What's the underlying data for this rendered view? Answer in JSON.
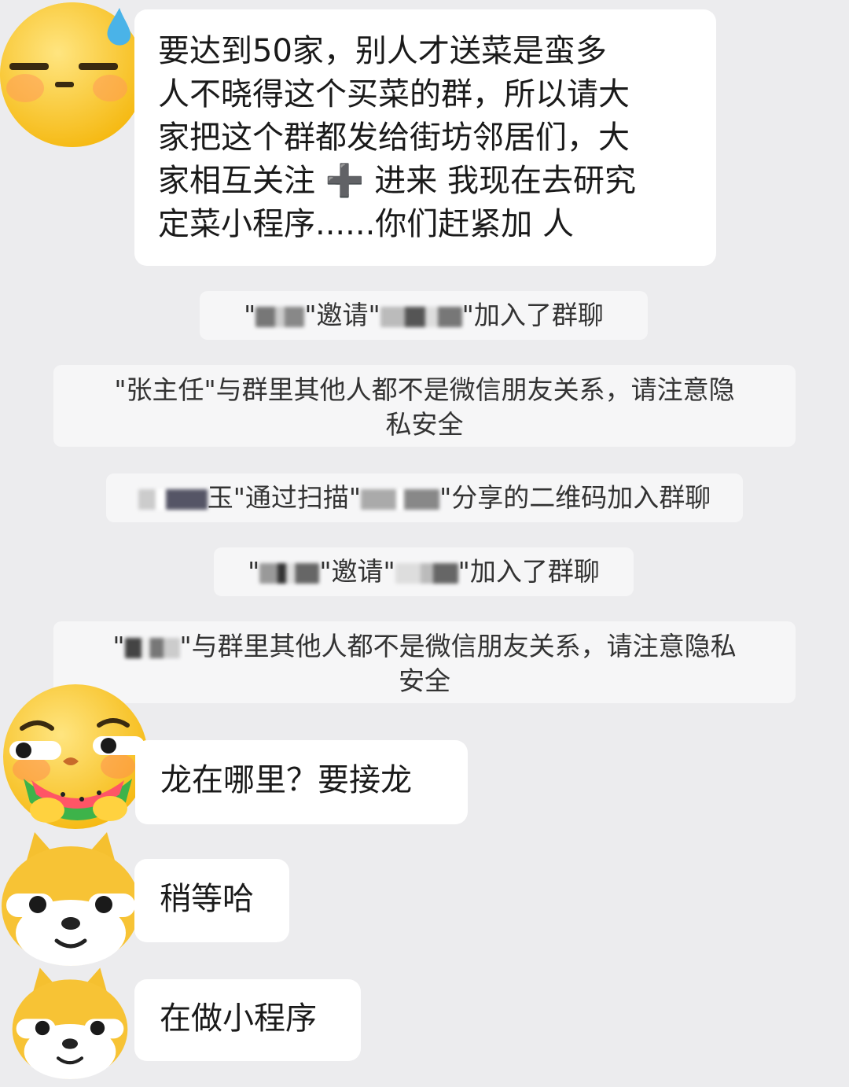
{
  "colors": {
    "background": "#ececee",
    "bubble": "#ffffff",
    "system_bubble": "#f6f6f7",
    "text": "#1a1a1a",
    "system_text": "#333333",
    "emoji_yellow": "#ffd23f"
  },
  "messages": [
    {
      "avatar_icon": "sweat-face-emoji-icon",
      "text": "要达到50家，别人才送菜是蛮多\n人不晓得这个买菜的群，所以请大\n家把这个群都发给街坊邻居们，大\n家相互关注 ➕ 进来 我现在去研究\n定菜小程序......你们赶紧加 人"
    },
    {
      "avatar_icon": "watermelon-face-emoji-icon",
      "text": "龙在哪里？要接龙"
    },
    {
      "avatar_icon": "shiba-dog-emoji-icon",
      "text": "稍等哈"
    },
    {
      "avatar_icon": "shiba-dog-emoji-icon",
      "text": "在做小程序"
    }
  ],
  "system_notices": [
    {
      "pre": "\"",
      "mid1": "\"邀请\"",
      "post": "\"加入了群聊"
    },
    {
      "line1": "\"张主任\"与群里其他人都不是微信朋友关系，请注意隐",
      "line2": "私安全"
    },
    {
      "mid1": "玉\"通过扫描\"",
      "post": "\"分享的二维码加入群聊"
    },
    {
      "pre": "\"",
      "mid1": "\"邀请\"",
      "post": "\"加入了群聊"
    },
    {
      "pre": "\"",
      "line1": "\"与群里其他人都不是微信朋友关系，请注意隐私",
      "line2": "安全"
    }
  ]
}
